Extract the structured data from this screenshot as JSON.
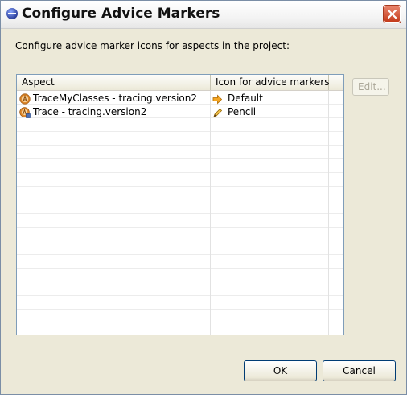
{
  "window": {
    "title": "Configure Advice Markers"
  },
  "description": "Configure advice marker icons for aspects in the project:",
  "table": {
    "columns": [
      "Aspect",
      "Icon for advice markers"
    ],
    "rows": [
      {
        "aspect": "TraceMyClasses - tracing.version2",
        "aspect_icon": "aspect-icon",
        "marker": "Default",
        "marker_icon": "arrow-right-icon"
      },
      {
        "aspect": "Trace - tracing.version2",
        "aspect_icon": "aspect-file-icon",
        "marker": "Pencil",
        "marker_icon": "pencil-icon"
      }
    ]
  },
  "buttons": {
    "edit": "Edit...",
    "ok": "OK",
    "cancel": "Cancel"
  }
}
